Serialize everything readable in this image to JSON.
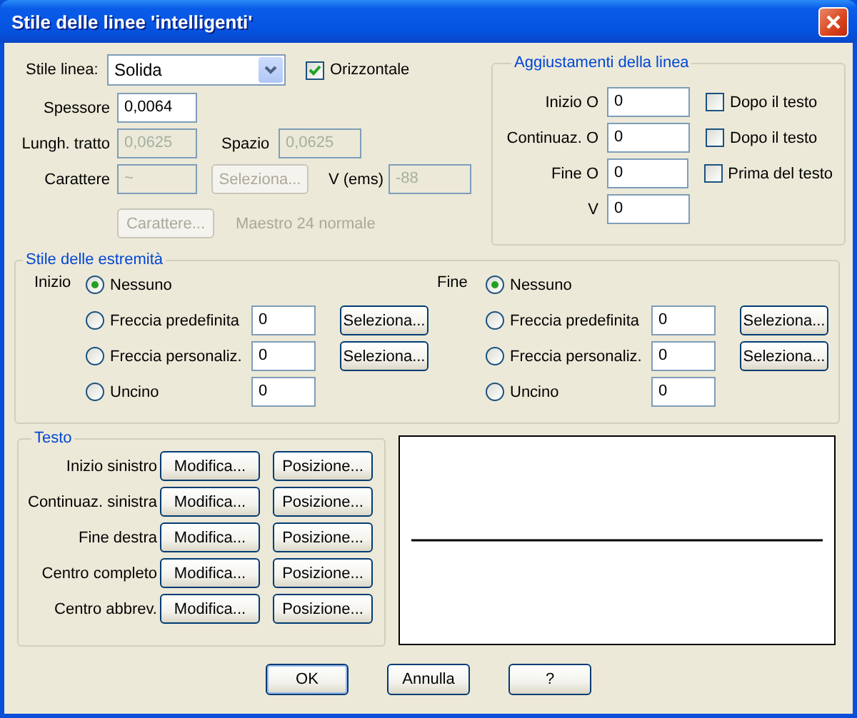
{
  "window": {
    "title": "Stile delle linee 'intelligenti'"
  },
  "line": {
    "style": {
      "label": "Stile linea:",
      "value": "Solida"
    },
    "horizontal": {
      "label": "Orizzontale",
      "checked": true
    },
    "thickness": {
      "label": "Spessore",
      "value": "0,0064",
      "disabled": false
    },
    "dash_length": {
      "label": "Lungh. tratto",
      "value": "0,0625",
      "disabled": true
    },
    "gap": {
      "label": "Spazio",
      "value": "0,0625",
      "disabled": true
    },
    "character": {
      "label": "Carattere",
      "value": "~",
      "disabled": true
    },
    "select_button": {
      "label": "Seleziona...",
      "disabled": true
    },
    "v_ems": {
      "label": "V (ems)",
      "value": "-88",
      "disabled": true
    },
    "font_button": {
      "label": "Carattere...",
      "disabled": true
    },
    "font_name": {
      "text": "Maestro 24 normale",
      "disabled": true
    }
  },
  "adjustments": {
    "title": "Aggiustamenti della linea",
    "rows": [
      {
        "label": "Inizio O",
        "value": "0",
        "checkbox": {
          "label": "Dopo il testo",
          "checked": false
        }
      },
      {
        "label": "Continuaz. O",
        "value": "0",
        "checkbox": {
          "label": "Dopo il testo",
          "checked": false
        }
      },
      {
        "label": "Fine O",
        "value": "0",
        "checkbox": {
          "label": "Prima del testo",
          "checked": false
        }
      },
      {
        "label": "V",
        "value": "0"
      }
    ]
  },
  "ends": {
    "title": "Stile delle estremità",
    "sides": [
      {
        "label": "Inizio",
        "options": [
          {
            "label": "Nessuno",
            "selected": true
          },
          {
            "label": "Freccia predefinita",
            "selected": false,
            "value": "0",
            "button": "Seleziona..."
          },
          {
            "label": "Freccia personaliz.",
            "selected": false,
            "value": "0",
            "button": "Seleziona..."
          },
          {
            "label": "Uncino",
            "selected": false,
            "value": "0"
          }
        ]
      },
      {
        "label": "Fine",
        "options": [
          {
            "label": "Nessuno",
            "selected": true
          },
          {
            "label": "Freccia predefinita",
            "selected": false,
            "value": "0",
            "button": "Seleziona..."
          },
          {
            "label": "Freccia personaliz.",
            "selected": false,
            "value": "0",
            "button": "Seleziona..."
          },
          {
            "label": "Uncino",
            "selected": false,
            "value": "0"
          }
        ]
      }
    ]
  },
  "text": {
    "title": "Testo",
    "rows": [
      {
        "label": "Inizio sinistro",
        "buttons": [
          "Modifica...",
          "Posizione..."
        ]
      },
      {
        "label": "Continuaz. sinistra",
        "buttons": [
          "Modifica...",
          "Posizione..."
        ]
      },
      {
        "label": "Fine destra",
        "buttons": [
          "Modifica...",
          "Posizione..."
        ]
      },
      {
        "label": "Centro completo",
        "buttons": [
          "Modifica...",
          "Posizione..."
        ]
      },
      {
        "label": "Centro abbrev.",
        "buttons": [
          "Modifica...",
          "Posizione..."
        ]
      }
    ]
  },
  "buttons": [
    {
      "label": "OK",
      "default": true
    },
    {
      "label": "Annulla",
      "default": false
    },
    {
      "label": "?",
      "default": false
    }
  ]
}
